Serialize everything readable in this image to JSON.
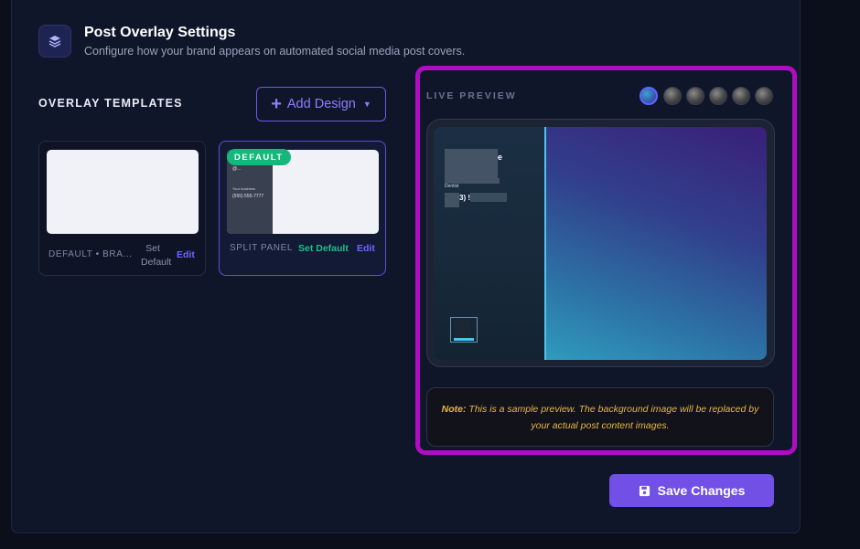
{
  "header": {
    "icon": "layers-icon",
    "title": "Post Overlay Settings",
    "subtitle": "Configure how your brand appears on automated social media post covers."
  },
  "templates": {
    "section_label": "OVERLAY TEMPLATES",
    "add_button_label": "Add Design",
    "items": [
      {
        "name": "DEFAULT • BRA...",
        "set_default_label": "Set Default",
        "edit_label": "Edit"
      },
      {
        "name": "SPLIT PANEL",
        "badge": "DEFAULT",
        "set_default_label": "Set Default",
        "edit_label": "Edit",
        "thumb_lines": [
          "@...",
          "Your business",
          "(555) 555-7777"
        ]
      }
    ]
  },
  "preview": {
    "label": "LIVE PREVIEW",
    "thumbnails": [
      "gradient",
      "image",
      "image",
      "image",
      "image",
      "image"
    ],
    "selected_thumbnail": 0,
    "content_lines": [
      "e",
      "Dentist",
      "3) !"
    ],
    "note_bold": "Note:",
    "note_text": " This is a sample preview. The background image will be replaced by your actual post content images."
  },
  "save_button_label": "Save Changes",
  "colors": {
    "accent": "#7250e6",
    "highlight_border": "#b00cc4",
    "badge_green": "#14b87a",
    "note_text": "#e8b547"
  }
}
